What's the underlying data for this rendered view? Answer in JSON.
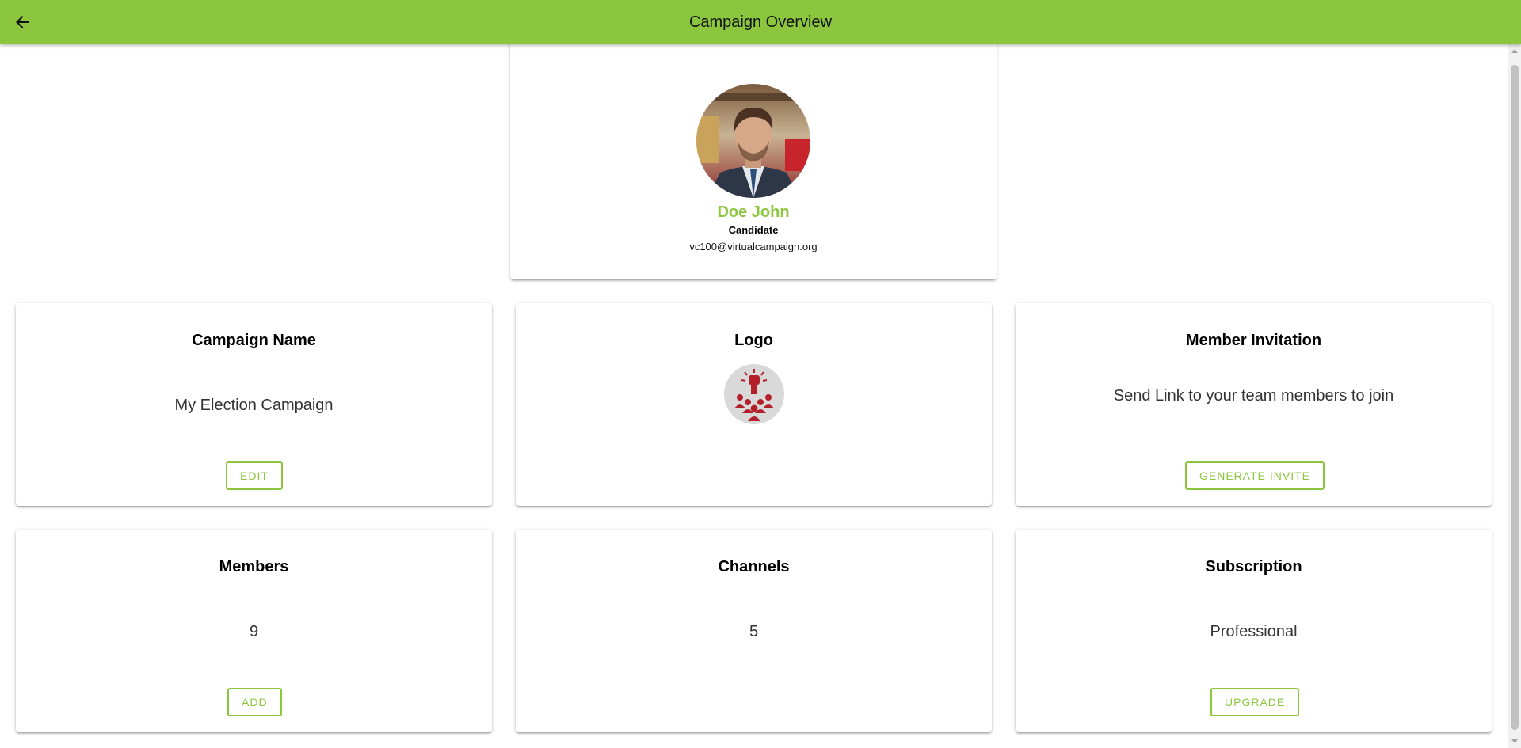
{
  "appbar": {
    "title": "Campaign Overview",
    "back_icon": "arrow-left-icon",
    "background": "#8cc63f"
  },
  "profile": {
    "name": "Doe John",
    "role": "Candidate",
    "email": "vc100@virtualcampaign.org",
    "name_color": "#8cc63f"
  },
  "tiles": {
    "campaign_name": {
      "title": "Campaign Name",
      "value": "My Election Campaign",
      "button": "EDIT"
    },
    "logo": {
      "title": "Logo",
      "icon": "raised-fist-crowd-logo"
    },
    "member_invitation": {
      "title": "Member Invitation",
      "value": "Send Link to your team members to join",
      "button": "GENERATE INVITE"
    },
    "members": {
      "title": "Members",
      "value": "9",
      "button": "ADD"
    },
    "channels": {
      "title": "Channels",
      "value": "5"
    },
    "subscription": {
      "title": "Subscription",
      "value": "Professional",
      "button": "UPGRADE"
    }
  },
  "colors": {
    "accent": "#8cc63f",
    "logo_red": "#b3202a"
  }
}
